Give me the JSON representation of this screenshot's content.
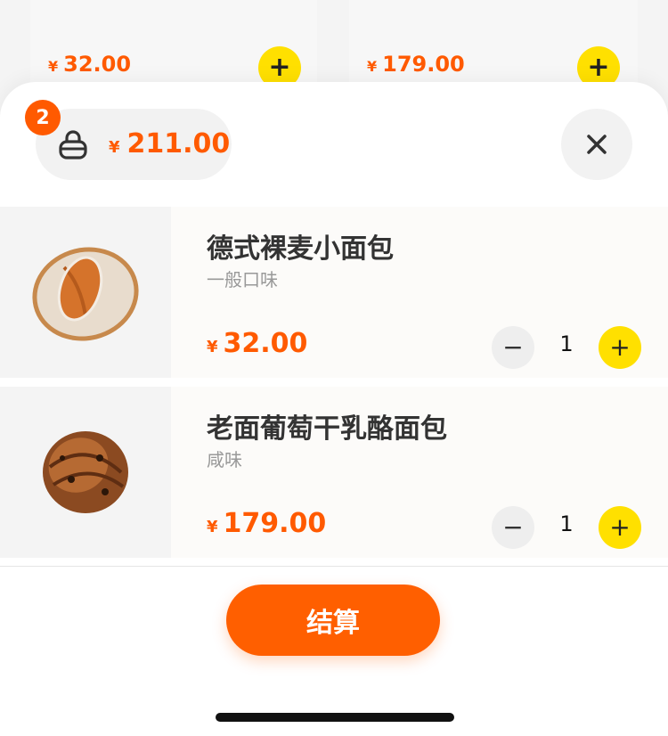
{
  "background_products": [
    {
      "currency": "¥",
      "price": "32.00",
      "add_label": "+"
    },
    {
      "currency": "¥",
      "price": "179.00",
      "add_label": "+"
    }
  ],
  "cart": {
    "count": "2",
    "icon": "shopping-basket-icon",
    "currency": "¥",
    "total": "211.00",
    "close_label": "×"
  },
  "items": [
    {
      "name": "德式裸麦小面包",
      "flavor": "一般口味",
      "currency": "¥",
      "price": "32.00",
      "minus_label": "−",
      "quantity": "1",
      "plus_label": "+"
    },
    {
      "name": "老面葡萄干乳酪面包",
      "flavor": "咸味",
      "currency": "¥",
      "price": "179.00",
      "minus_label": "−",
      "quantity": "1",
      "plus_label": "+"
    }
  ],
  "checkout_label": "结算",
  "colors": {
    "accent": "#ff5a00",
    "add_button": "#ffe000"
  }
}
